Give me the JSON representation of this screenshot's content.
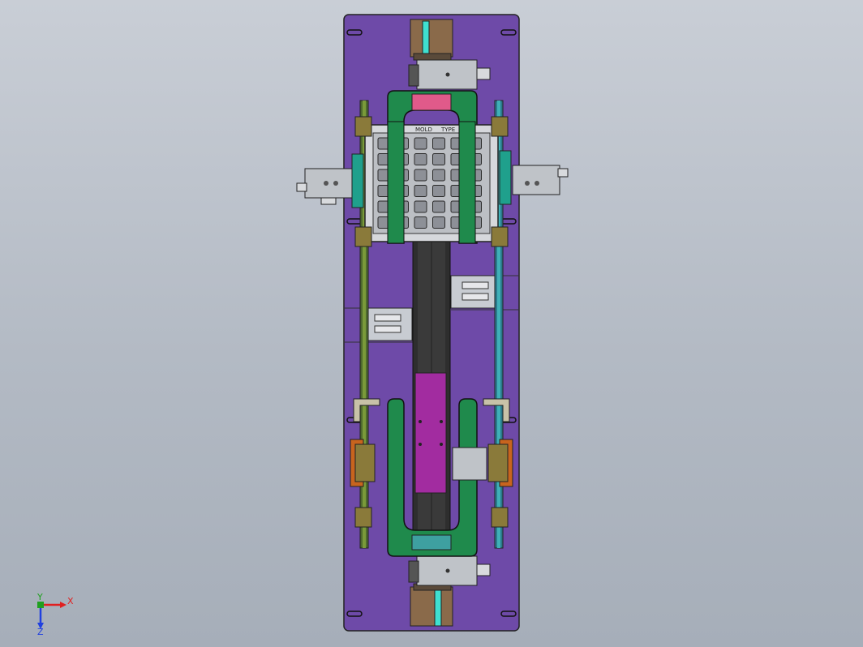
{
  "viewport": {
    "background_top": "#c9ced6",
    "background_bottom": "#a6aeb9"
  },
  "assembly": {
    "base_plate_color": "#6e4aa8",
    "carrier_color": "#1f8a4c",
    "rail_color": "#2b9e8c",
    "slide_color": "#a22ca0",
    "motor_color": "#8a6a4a",
    "cylinder_color": "#bfc3c8",
    "bracket_color": "#8a7a3a",
    "clamp_color": "#c8641e",
    "tray_label_left": "MOLD",
    "tray_label_right": "TYPE"
  },
  "triad": {
    "x_label": "X",
    "y_label": "Y",
    "z_label": "Z",
    "x_color": "#e02020",
    "y_color": "#20a020",
    "z_color": "#2040e0"
  }
}
